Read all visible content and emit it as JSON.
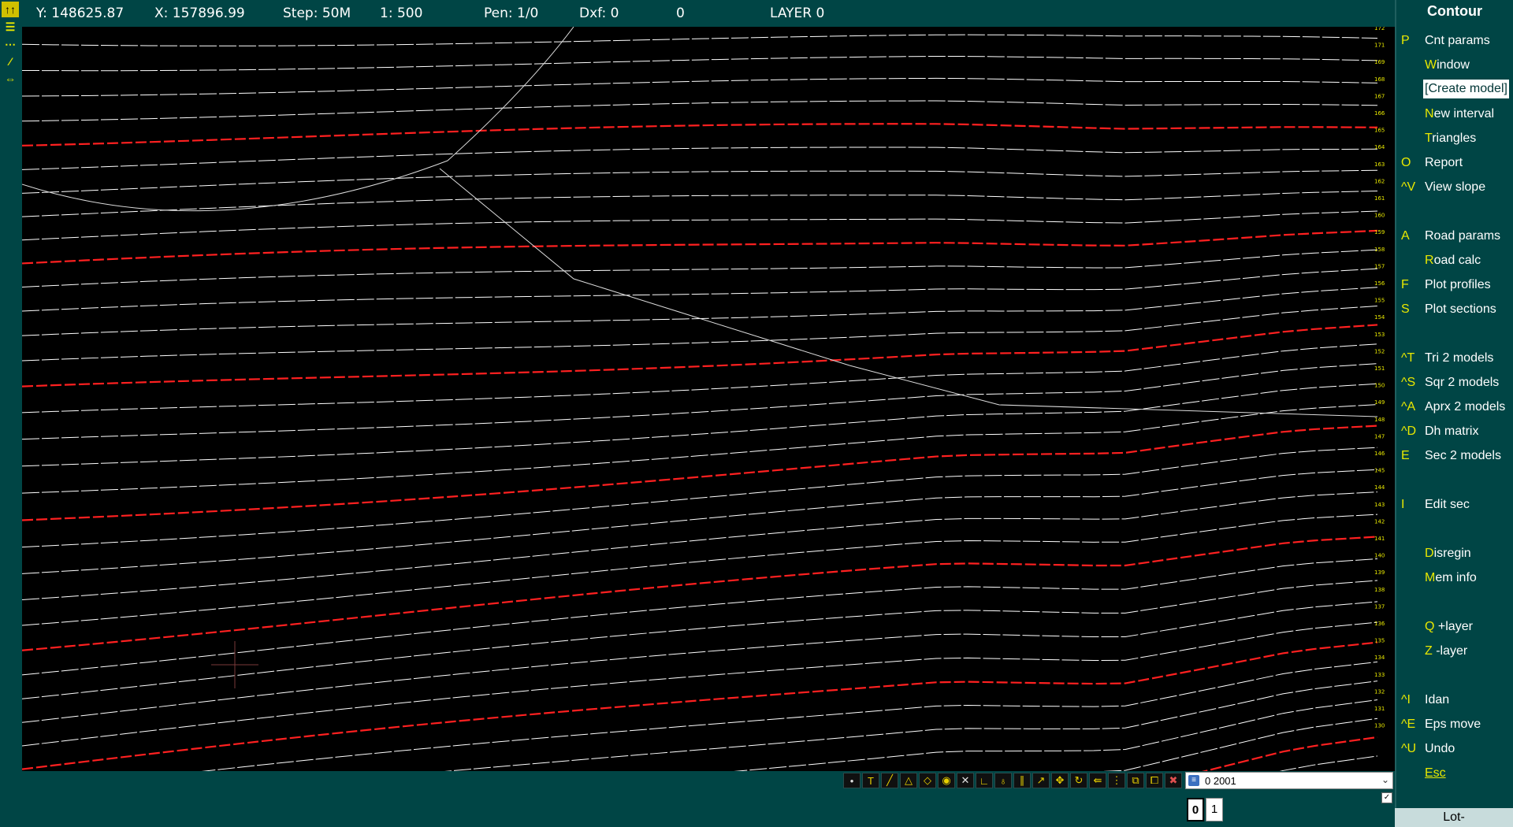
{
  "status": {
    "y": "Y: 148625.87",
    "x": "X: 157896.99",
    "step": "Step: 50M",
    "scale": "1: 500",
    "pen": "Pen: 1/0",
    "dxf": "Dxf: 0",
    "count": "0",
    "layer": "LAYER 0"
  },
  "menu": {
    "title": "Contour",
    "items": [
      {
        "key": "P",
        "hk": "",
        "rest": "Cnt params"
      },
      {
        "key": "",
        "hk": "W",
        "rest": "indow"
      },
      {
        "key": "",
        "hk": "",
        "rest": "[Create model]"
      },
      {
        "key": "",
        "hk": "N",
        "rest": "ew interval"
      },
      {
        "key": "",
        "hk": "T",
        "rest": "riangles"
      },
      {
        "key": "O",
        "hk": "",
        "rest": "Report"
      },
      {
        "key": "^V",
        "hk": "",
        "rest": "View slope"
      },
      {
        "key": "A",
        "hk": "",
        "rest": "Road params"
      },
      {
        "key": "",
        "hk": "R",
        "rest": "oad calc"
      },
      {
        "key": "F",
        "hk": "",
        "rest": "Plot profiles"
      },
      {
        "key": "S",
        "hk": "",
        "rest": "Plot sections"
      },
      {
        "key": "^T",
        "hk": "",
        "rest": "Tri 2 models"
      },
      {
        "key": "^S",
        "hk": "",
        "rest": "Sqr 2 models"
      },
      {
        "key": "^A",
        "hk": "",
        "rest": "Aprx 2 models"
      },
      {
        "key": "^D",
        "hk": "",
        "rest": "Dh matrix"
      },
      {
        "key": "E",
        "hk": "",
        "rest": "Sec 2 models"
      },
      {
        "key": "I",
        "hk": "",
        "rest": "Edit sec"
      },
      {
        "key": "",
        "hk": "D",
        "rest": "isregin"
      },
      {
        "key": "",
        "hk": "M",
        "rest": "em info"
      },
      {
        "key": "",
        "hk": "Q",
        "rest": " +layer"
      },
      {
        "key": "",
        "hk": "Z",
        "rest": " -layer"
      },
      {
        "key": "^I",
        "hk": "",
        "rest": "Idan"
      },
      {
        "key": "^E",
        "hk": "",
        "rest": "Eps move"
      },
      {
        "key": "^U",
        "hk": "",
        "rest": "Undo"
      },
      {
        "key": "",
        "hk": "",
        "rest": "Esc"
      }
    ],
    "footer": "Lot-"
  },
  "layer_select": {
    "value": "0  2001"
  },
  "pens": [
    "0",
    "1"
  ],
  "checkbox": "✓",
  "bottom_tool_icons": [
    "point-icon",
    "text-icon",
    "line-icon",
    "arc-icon",
    "diamond-icon",
    "circle-icon",
    "cross-icon",
    "corner-icon",
    "bucket-icon",
    "parallel-icon",
    "arrow-icon",
    "move-icon",
    "rotate-icon",
    "shrink-icon",
    "grid-icon",
    "copy-icon",
    "paste-icon",
    "delete-icon"
  ],
  "left_tool_icons": [
    "up-arrow-icon",
    "layers-icon",
    "dash-line-icon",
    "slope-icon",
    "swap-icon"
  ],
  "colors": {
    "background": "#004545",
    "canvas": "#000000",
    "contour": "#ffffff",
    "index_contour": "#ff2020",
    "hotkey": "#e8e800"
  },
  "contour_labels": [
    "172",
    "171",
    "169",
    "168",
    "167",
    "166",
    "165",
    "164",
    "163",
    "162",
    "161",
    "160",
    "159",
    "158",
    "157",
    "156",
    "155",
    "154",
    "153",
    "152",
    "151",
    "150",
    "149",
    "148",
    "147",
    "146",
    "145",
    "144",
    "143",
    "142",
    "141",
    "140",
    "139",
    "138",
    "137",
    "136",
    "135",
    "134",
    "133",
    "132",
    "131",
    "130"
  ]
}
